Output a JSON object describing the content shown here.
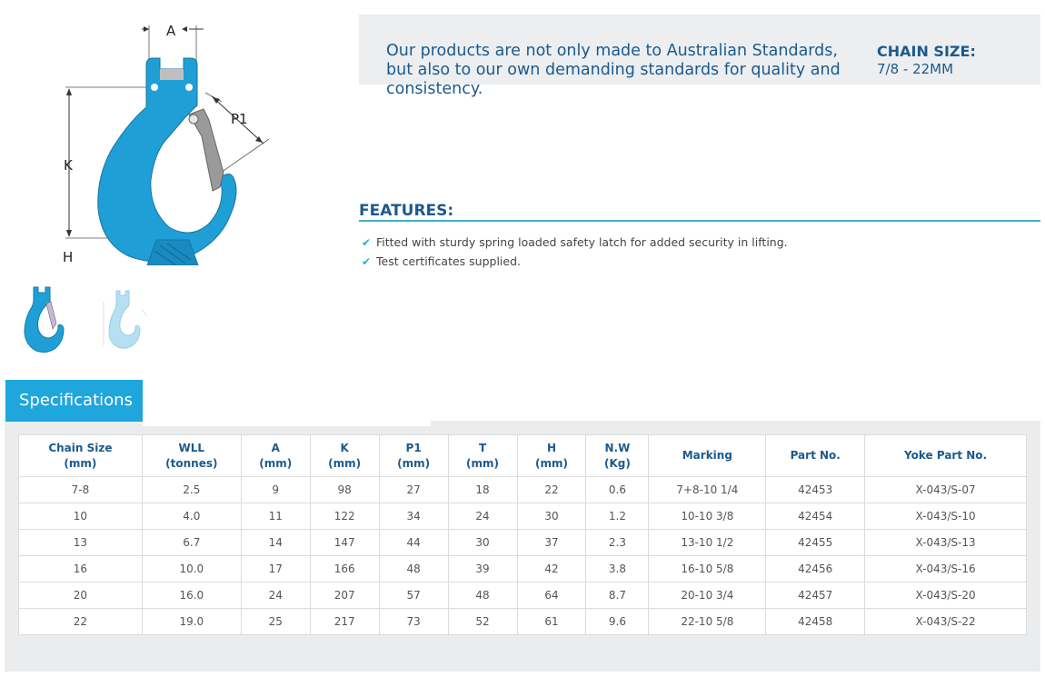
{
  "product": {
    "intro_text": "Our products are not only made to Australian Standards, but also to our own demanding standards for quality and consistency.",
    "chain_size_label": "CHAIN SIZE:",
    "chain_size_value": "7/8 - 22MM",
    "diagram_labels": {
      "a": "A",
      "p1": "P1",
      "k": "K",
      "h": "H"
    },
    "thumbnails": [
      "hook-thumbnail-color",
      "hook-thumbnail-diagram"
    ],
    "colors": {
      "hook_blue": "#1f9fd6",
      "latch_gray": "#9a9a9a",
      "brand_blue": "#1c5a8e",
      "tab_blue": "#1ea6dd"
    }
  },
  "features": {
    "title": "FEATURES:",
    "items": [
      "Fitted with sturdy spring loaded safety latch for added security in lifting.",
      "Test certificates supplied."
    ]
  },
  "specifications": {
    "tab_label": "Specifications",
    "columns": [
      [
        "Chain Size",
        "(mm)"
      ],
      [
        "WLL",
        "(tonnes)"
      ],
      [
        "A",
        "(mm)"
      ],
      [
        "K",
        "(mm)"
      ],
      [
        "P1",
        "(mm)"
      ],
      [
        "T",
        "(mm)"
      ],
      [
        "H",
        "(mm)"
      ],
      [
        "N.W",
        "(Kg)"
      ],
      [
        "Marking",
        ""
      ],
      [
        "Part No.",
        ""
      ],
      [
        "Yoke Part No.",
        ""
      ]
    ],
    "rows": [
      [
        "7-8",
        "2.5",
        "9",
        "98",
        "27",
        "18",
        "22",
        "0.6",
        "7+8-10 1/4",
        "42453",
        "X-043/S-07"
      ],
      [
        "10",
        "4.0",
        "11",
        "122",
        "34",
        "24",
        "30",
        "1.2",
        "10-10 3/8",
        "42454",
        "X-043/S-10"
      ],
      [
        "13",
        "6.7",
        "14",
        "147",
        "44",
        "30",
        "37",
        "2.3",
        "13-10 1/2",
        "42455",
        "X-043/S-13"
      ],
      [
        "16",
        "10.0",
        "17",
        "166",
        "48",
        "39",
        "42",
        "3.8",
        "16-10 5/8",
        "42456",
        "X-043/S-16"
      ],
      [
        "20",
        "16.0",
        "24",
        "207",
        "57",
        "48",
        "64",
        "8.7",
        "20-10 3/4",
        "42457",
        "X-043/S-20"
      ],
      [
        "22",
        "19.0",
        "25",
        "217",
        "73",
        "52",
        "61",
        "9.6",
        "22-10 5/8",
        "42458",
        "X-043/S-22"
      ]
    ]
  }
}
